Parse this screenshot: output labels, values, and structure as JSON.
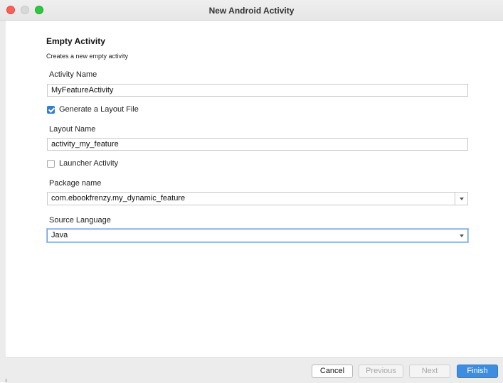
{
  "window": {
    "title": "New Android Activity"
  },
  "template": {
    "heading": "Empty Activity",
    "description": "Creates a new empty activity"
  },
  "form": {
    "activity_name": {
      "label": "Activity Name",
      "value": "MyFeatureActivity"
    },
    "generate_layout": {
      "label": "Generate a Layout File",
      "checked": true
    },
    "layout_name": {
      "label": "Layout Name",
      "value": "activity_my_feature"
    },
    "launcher_activity": {
      "label": "Launcher Activity",
      "checked": false
    },
    "package_name": {
      "label": "Package name",
      "value": "com.ebookfrenzy.my_dynamic_feature"
    },
    "source_language": {
      "label": "Source Language",
      "value": "Java"
    }
  },
  "buttons": {
    "cancel": "Cancel",
    "previous": "Previous",
    "next": "Next",
    "finish": "Finish"
  },
  "colors": {
    "accent": "#3d8ee0",
    "close": "#fe5f57",
    "zoom": "#2bc840"
  }
}
